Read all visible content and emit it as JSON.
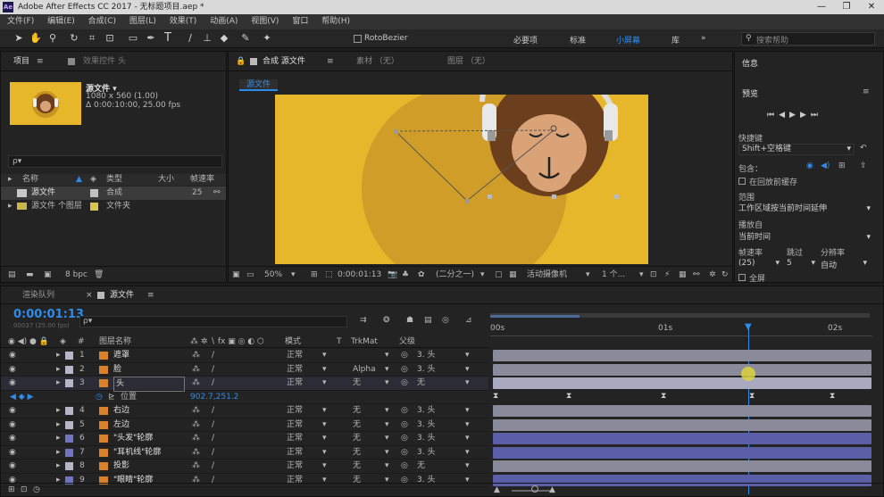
{
  "app": {
    "title": "Adobe After Effects CC 2017 - 无标题项目.aep *",
    "logo": "Ae",
    "win_controls": [
      "—",
      "❐",
      "✕"
    ]
  },
  "menu": [
    "文件(F)",
    "编辑(E)",
    "合成(C)",
    "图层(L)",
    "效果(T)",
    "动画(A)",
    "视图(V)",
    "窗口",
    "帮助(H)"
  ],
  "toolbar": {
    "icons": [
      "selection-tool",
      "hand-tool",
      "zoom-tool",
      "rotate-tool",
      "camera-tool",
      "pan-behind-tool",
      "rectangle-tool",
      "pen-tool",
      "type-tool",
      "brush-tool",
      "clone-stamp-tool",
      "eraser-tool",
      "roto-brush-tool",
      "puppet-tool"
    ],
    "rotobezier": "RotoBezier",
    "workspaces": [
      "必要项",
      "标准",
      "小屏幕",
      "库"
    ],
    "active_workspace": "小屏幕",
    "search_help": "搜索帮助"
  },
  "project_panel": {
    "tab_project": "项目",
    "tab_effects": "效果控件 头",
    "comp_name": "源文件 ▾",
    "comp_size": "1080 x 560 (1.00)",
    "comp_duration": "Δ 0:00:10:00, 25.00 fps",
    "search_placeholder": "ρ▾",
    "columns": [
      "名称",
      "类型",
      "大小",
      "帧速率"
    ],
    "items": [
      {
        "name": "源文件",
        "type": "合成",
        "size": "",
        "fps": "25"
      },
      {
        "name": "源文件 个图层",
        "type": "文件夹",
        "size": "",
        "fps": ""
      }
    ],
    "bpc": "8 bpc"
  },
  "viewer": {
    "tab_comp": "合成 源文件",
    "tab_footage": "素材 （无）",
    "tab_layer": "图层 （无）",
    "breadcrumb": "源文件",
    "zoom": "50%",
    "timecode": "0:00:01:13",
    "resolution": "(二分之一)",
    "camera": "活动摄像机",
    "views": "1 个..."
  },
  "right_panel": {
    "info_tab": "信息",
    "preview_tab": "预览",
    "shortcut_label": "快捷键",
    "shortcut_value": "Shift+空格键",
    "include_label": "包含：",
    "cache_label": "在回放前缓存",
    "range_label": "范围",
    "range_value": "工作区域按当前时间延伸",
    "play_from_label": "播放自",
    "play_from_value": "当前时间",
    "fps_label": "帧速率",
    "skip_label": "跳过",
    "res_label": "分辨率",
    "fps_value": "(25)",
    "skip_value": "5",
    "res_value": "自动",
    "fullscreen_label": "全屏"
  },
  "timeline": {
    "tab_render": "渲染队列",
    "tab_comp": "源文件",
    "timecode": "0:00:01:13",
    "timecode_sub": "00037 (25.00 fps)",
    "search_placeholder": "ρ▾",
    "col_source": "图层名称",
    "col_mode": "模式",
    "col_t": "T",
    "col_trkmat": "TrkMat",
    "col_parent": "父级",
    "ruler": [
      "00s",
      "01s",
      "02s"
    ],
    "layers": [
      {
        "num": "1",
        "name": "遮罩",
        "mode": "正常",
        "trkmat": "",
        "parent": "3. 头",
        "color": "#b6b6c8",
        "bar": "#8a8a9a"
      },
      {
        "num": "2",
        "name": "脸",
        "mode": "正常",
        "trkmat": "Alpha",
        "parent": "3. 头",
        "color": "#b6b6c8",
        "bar": "#8a8a9a"
      },
      {
        "num": "3",
        "name": "头",
        "mode": "正常",
        "trkmat": "无",
        "parent": "无",
        "color": "#b6b6c8",
        "bar": "#a9a9c0"
      },
      {
        "num": "",
        "name": "位置",
        "mode": "",
        "trkmat": "",
        "parent": "",
        "value": "902.7,251.2",
        "color": "",
        "bar": ""
      },
      {
        "num": "4",
        "name": "右边",
        "mode": "正常",
        "trkmat": "无",
        "parent": "3. 头",
        "color": "#b6b6c8",
        "bar": "#8a8a9a"
      },
      {
        "num": "5",
        "name": "左边",
        "mode": "正常",
        "trkmat": "无",
        "parent": "3. 头",
        "color": "#b6b6c8",
        "bar": "#8a8a9a"
      },
      {
        "num": "6",
        "name": "\"头发\"轮廓",
        "mode": "正常",
        "trkmat": "无",
        "parent": "3. 头",
        "color": "#6f74c4",
        "bar": "#5a5fa8"
      },
      {
        "num": "7",
        "name": "\"耳机线\"轮廓",
        "mode": "正常",
        "trkmat": "无",
        "parent": "3. 头",
        "color": "#6f74c4",
        "bar": "#5a5fa8"
      },
      {
        "num": "8",
        "name": "投影",
        "mode": "正常",
        "trkmat": "无",
        "parent": "无",
        "color": "#b6b6c8",
        "bar": "#8a8a9a"
      },
      {
        "num": "9",
        "name": "\"眼睛\"轮廓",
        "mode": "正常",
        "trkmat": "无",
        "parent": "3. 头",
        "color": "#6f74c4",
        "bar": "#5a5fa8"
      }
    ]
  }
}
